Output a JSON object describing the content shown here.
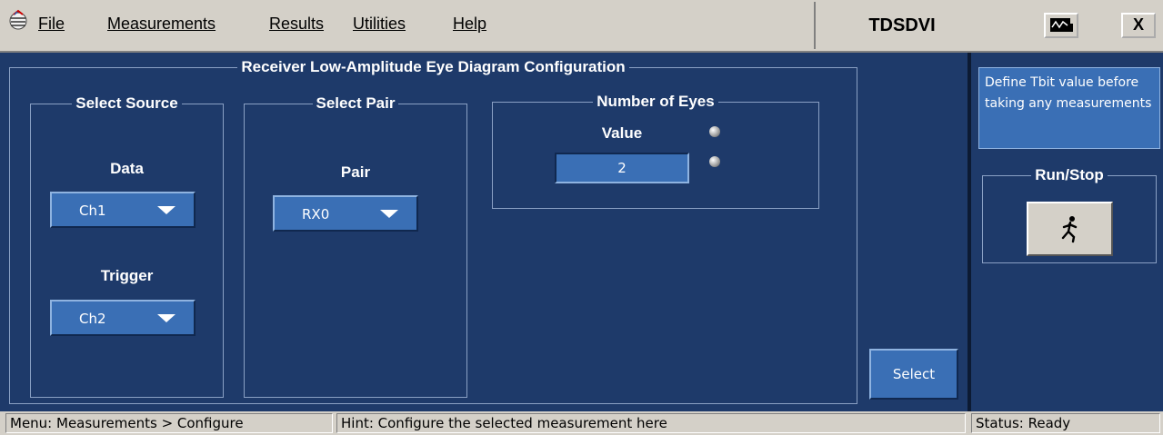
{
  "menu": {
    "items": [
      {
        "label": "File"
      },
      {
        "label": "Measurements"
      },
      {
        "label": "Results"
      },
      {
        "label": "Utilities"
      },
      {
        "label": "Help"
      }
    ],
    "app_title": "TDSDVI",
    "close_label": "X"
  },
  "config": {
    "title": "Receiver Low-Amplitude Eye Diagram Configuration",
    "select_source": {
      "title": "Select Source",
      "data_label": "Data",
      "data_value": "Ch1",
      "trigger_label": "Trigger",
      "trigger_value": "Ch2"
    },
    "select_pair": {
      "title": "Select Pair",
      "pair_label": "Pair",
      "pair_value": "RX0"
    },
    "eyes": {
      "title": "Number of Eyes",
      "value_label": "Value",
      "value": "2"
    },
    "select_button": "Select"
  },
  "side": {
    "hint": "Define Tbit value before taking any measurements",
    "runstop_title": "Run/Stop"
  },
  "status": {
    "menu": "Menu: Measurements > Configure",
    "hint": "Hint: Configure the selected measurement here",
    "status": "Status: Ready"
  },
  "colors": {
    "panel": "#1e3a6a",
    "control": "#3a6fb5",
    "chrome": "#d4d0c8"
  }
}
